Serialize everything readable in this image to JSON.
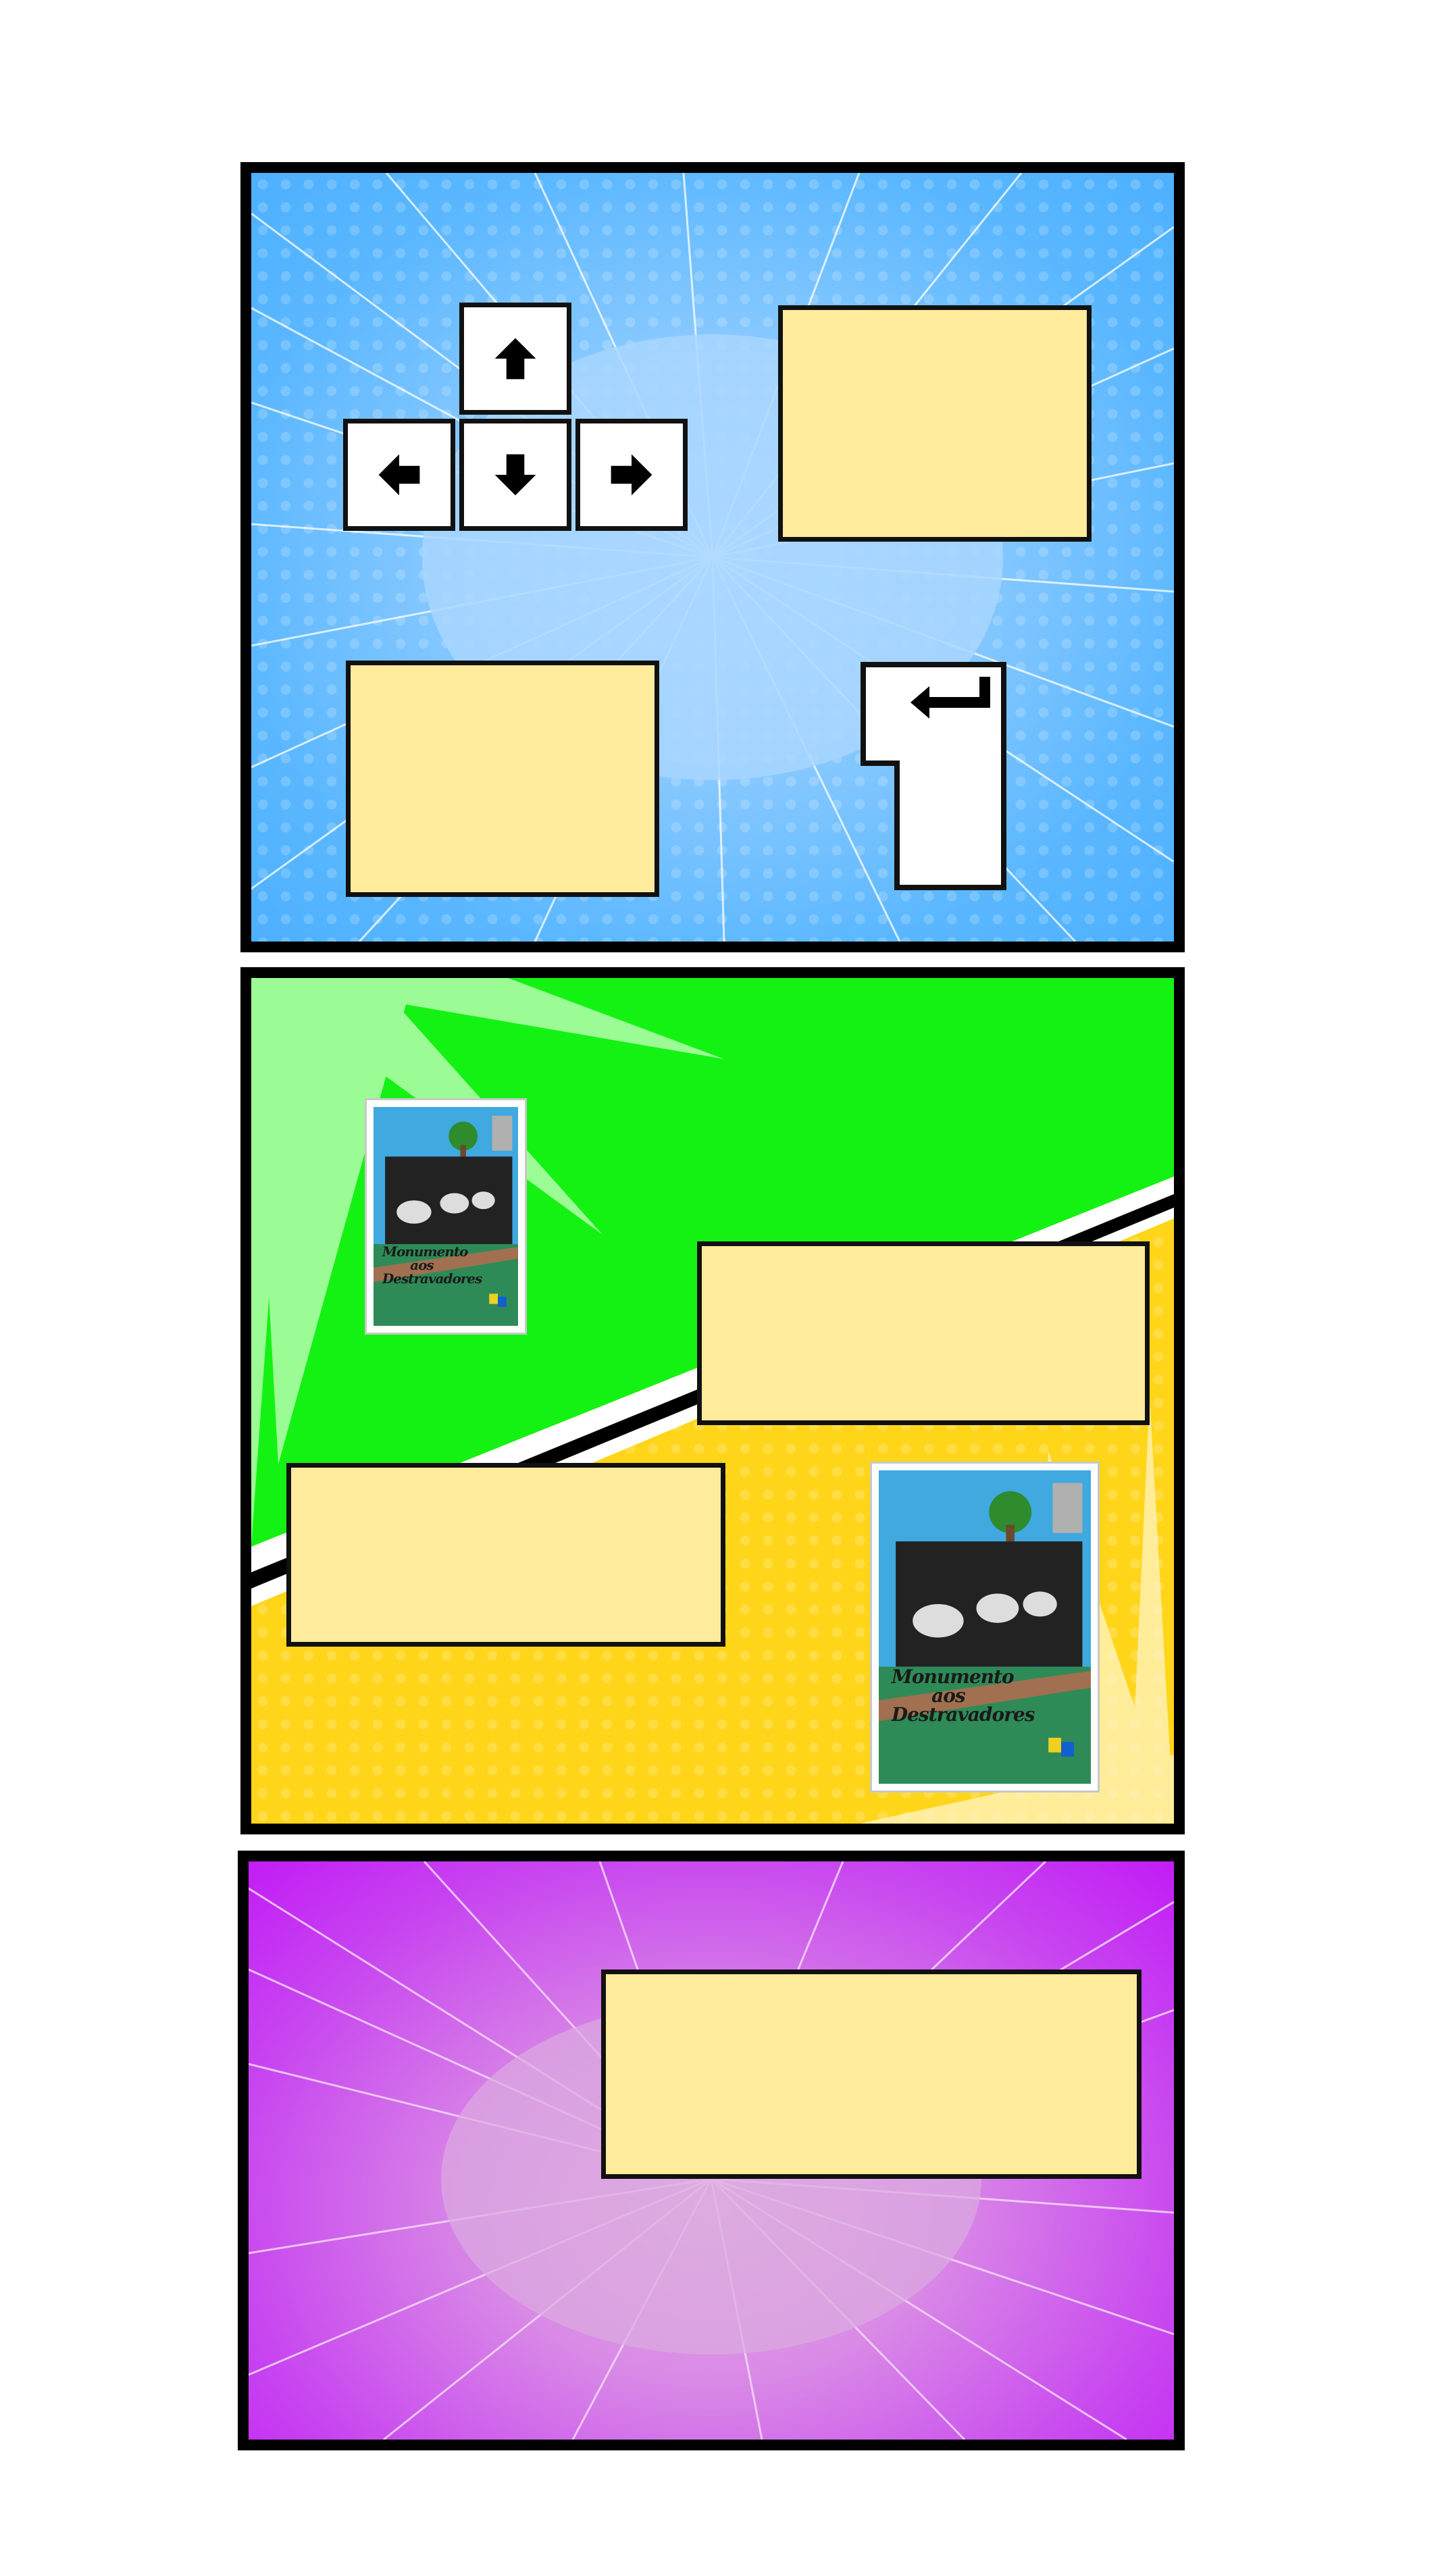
{
  "colors": {
    "panel1_bg": "#5ab7ff",
    "panel2_green": "#14f214",
    "panel2_yellow": "#ffd51a",
    "panel3_bg": "#c21cf5",
    "text_box": "#ffeb9c",
    "border": "#000000"
  },
  "panel1": {
    "keys": [
      {
        "name": "arrow-up-key",
        "icon": "arrow-up-icon"
      },
      {
        "name": "arrow-left-key",
        "icon": "arrow-left-icon"
      },
      {
        "name": "arrow-down-key",
        "icon": "arrow-down-icon"
      },
      {
        "name": "arrow-right-key",
        "icon": "arrow-right-icon"
      }
    ],
    "enter_key_icon": "enter-arrow-icon"
  },
  "poster": {
    "title_line1": "Monumento",
    "title_line2": "aos",
    "title_line3": "Destravadores"
  }
}
